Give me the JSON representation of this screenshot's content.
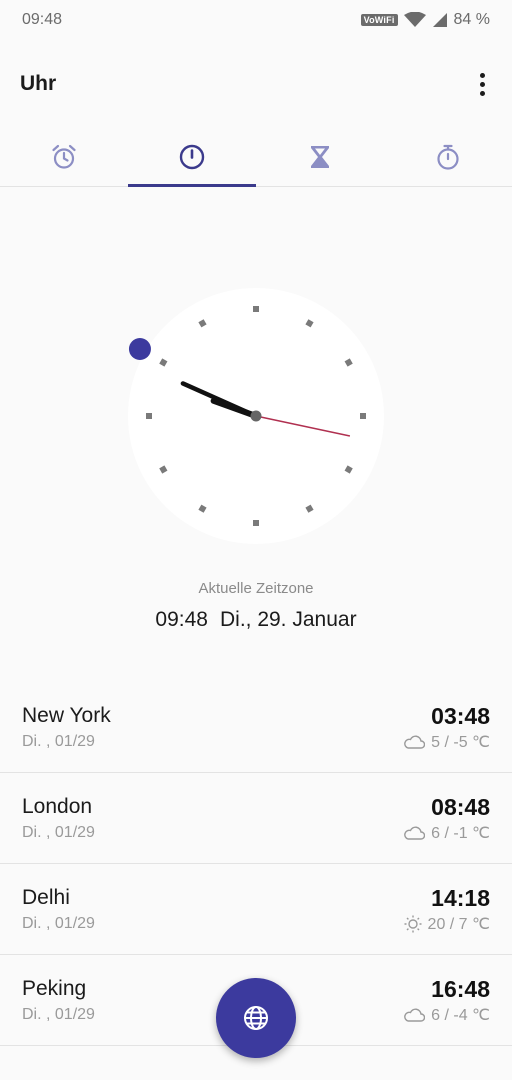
{
  "status_bar": {
    "time": "09:48",
    "wifi_badge": "VoWiFi",
    "battery": "84 %"
  },
  "app": {
    "title": "Uhr"
  },
  "tabs": [
    {
      "icon": "alarm-icon"
    },
    {
      "icon": "clock-icon",
      "active": true
    },
    {
      "icon": "hourglass-icon"
    },
    {
      "icon": "stopwatch-icon"
    }
  ],
  "analog_clock": {
    "hours": 9,
    "minutes": 48,
    "seconds": 17
  },
  "current_timezone": {
    "label": "Aktuelle Zeitzone",
    "time": "09:48",
    "date": "Di., 29. Januar"
  },
  "cities": [
    {
      "name": "New York",
      "date": "Di. , 01/29",
      "time": "03:48",
      "weather_icon": "cloud-icon",
      "temps": "5 / -5 ℃"
    },
    {
      "name": "London",
      "date": "Di. , 01/29",
      "time": "08:48",
      "weather_icon": "cloud-icon",
      "temps": "6 / -1 ℃"
    },
    {
      "name": "Delhi",
      "date": "Di. , 01/29",
      "time": "14:18",
      "weather_icon": "sun-icon",
      "temps": "20 / 7 ℃"
    },
    {
      "name": "Peking",
      "date": "Di. , 01/29",
      "time": "16:48",
      "weather_icon": "cloud-icon",
      "temps": "6 / -4 ℃"
    }
  ],
  "fab": {
    "icon": "globe-icon"
  },
  "colors": {
    "accent": "#3c3a9e",
    "tab_icon": "#8c8ec4",
    "second_hand": "#b03050"
  }
}
